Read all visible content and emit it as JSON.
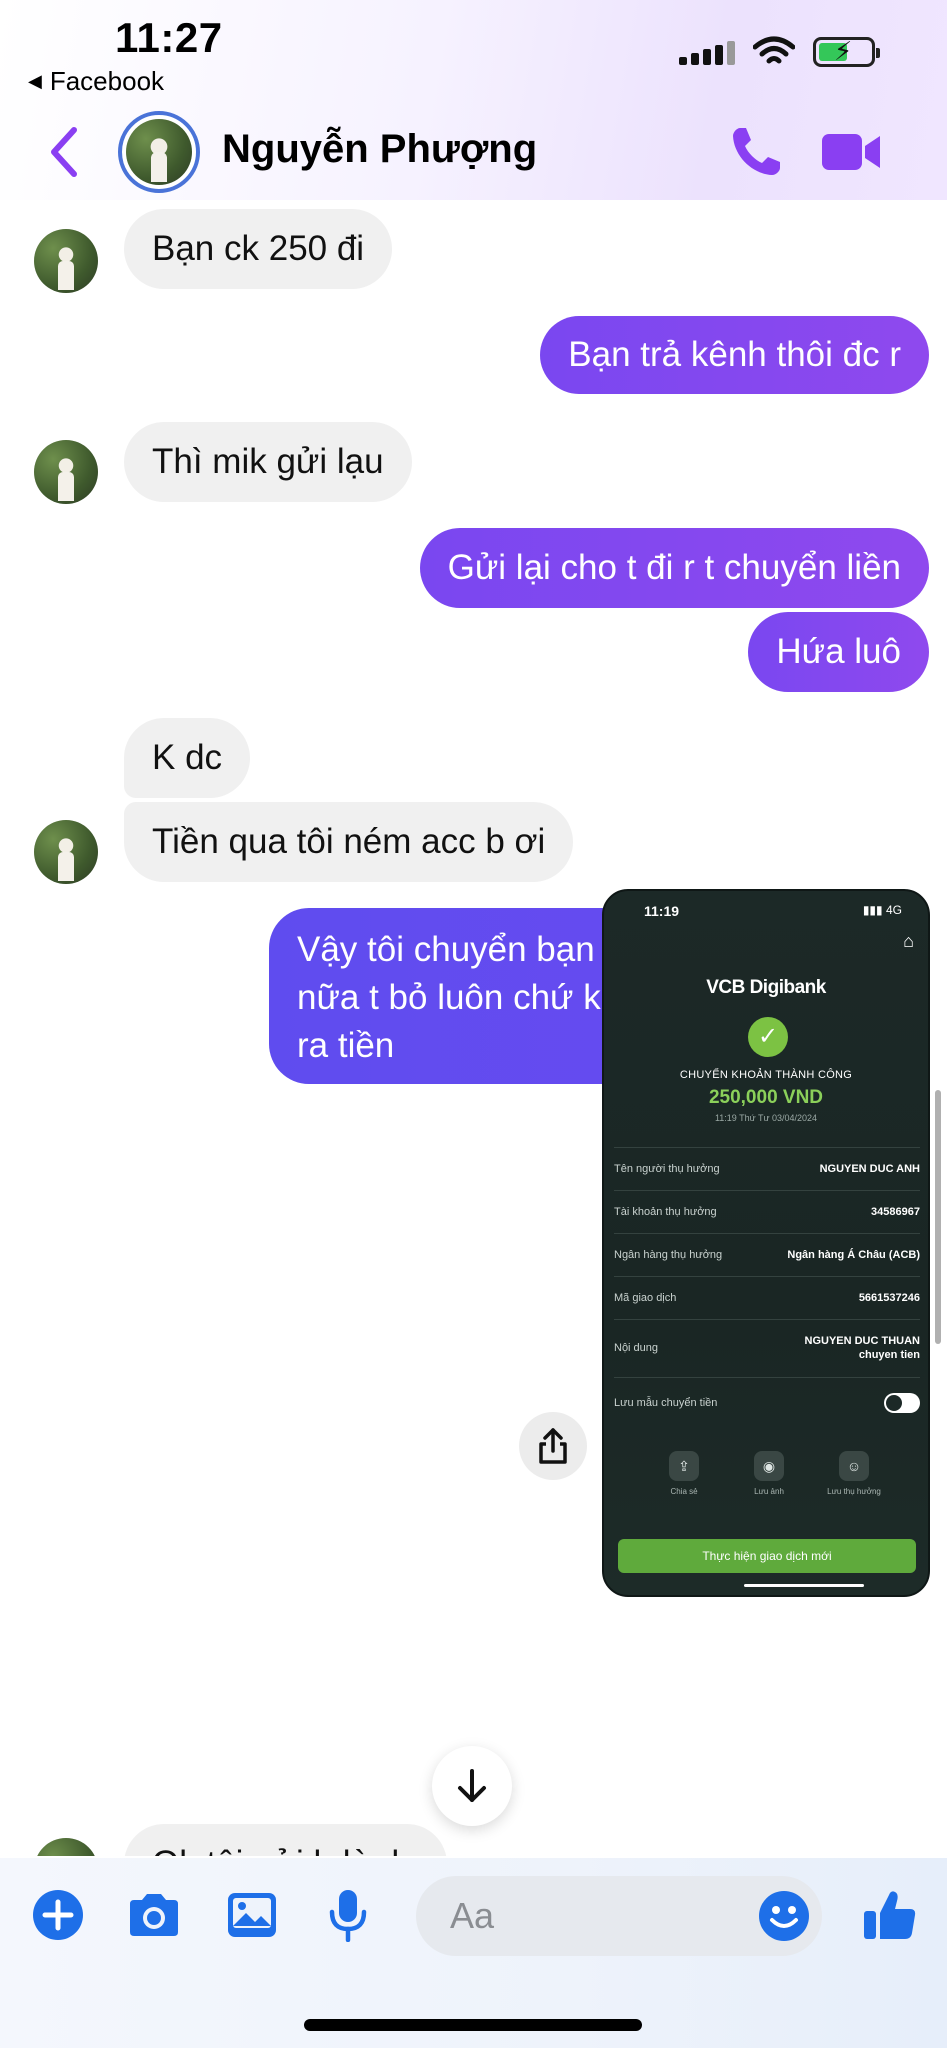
{
  "status_bar": {
    "time": "11:27",
    "back_app": "Facebook"
  },
  "header": {
    "contact_name": "Nguyễn Phượng"
  },
  "messages": [
    {
      "dir": "in",
      "text": "Bạn ck 250 đi"
    },
    {
      "dir": "out",
      "text": "Bạn trả kênh thôi đc r"
    },
    {
      "dir": "in",
      "text": "Thì mik gửi lạu"
    },
    {
      "dir": "out",
      "text": "Gửi lại cho t đi r t chuyển liền"
    },
    {
      "dir": "out",
      "text": "Hứa luô"
    },
    {
      "dir": "in",
      "text": "K dc"
    },
    {
      "dir": "in",
      "text": "Tiền qua tôi ném acc b ơi"
    },
    {
      "dir": "out",
      "lines": [
        "Vậy tôi chuyển bạn nếu bạn ko ném",
        "nữa t bỏ luôn chứ kênh cũng ko làm",
        "ra tiền"
      ]
    },
    {
      "dir": "in",
      "text": "Ok tôi gửi b lè dạ"
    }
  ],
  "receipt": {
    "time": "11:19",
    "network": "4G",
    "brand": "VCB Digibank",
    "status": "CHUYỂN KHOẢN THÀNH CÔNG",
    "amount": "250,000 VND",
    "datetime": "11:19 Thứ Tư 03/04/2024",
    "rows": [
      {
        "label": "Tên người thụ hưởng",
        "value": "NGUYEN DUC ANH"
      },
      {
        "label": "Tài khoản thụ hưởng",
        "value": "34586967"
      },
      {
        "label": "Ngân hàng thụ hưởng",
        "value": "Ngân hàng Á Châu (ACB)"
      },
      {
        "label": "Mã giao dịch",
        "value": "5661537246"
      },
      {
        "label": "Nội dung",
        "value": "NGUYEN DUC THUAN chuyen tien"
      }
    ],
    "save_template_label": "Lưu mẫu chuyển tiền",
    "actions": [
      "Chia sẻ",
      "Lưu ảnh",
      "Lưu thụ hưởng"
    ],
    "new_transaction": "Thực hiện giao dịch mới"
  },
  "composer": {
    "placeholder": "Aa"
  },
  "colors": {
    "accent": "#7a3ff0",
    "outgoing": "#8a48ef",
    "outgoing_blue": "#6249ef",
    "incoming": "#f0f0f0",
    "link_blue": "#1e6fe8"
  }
}
